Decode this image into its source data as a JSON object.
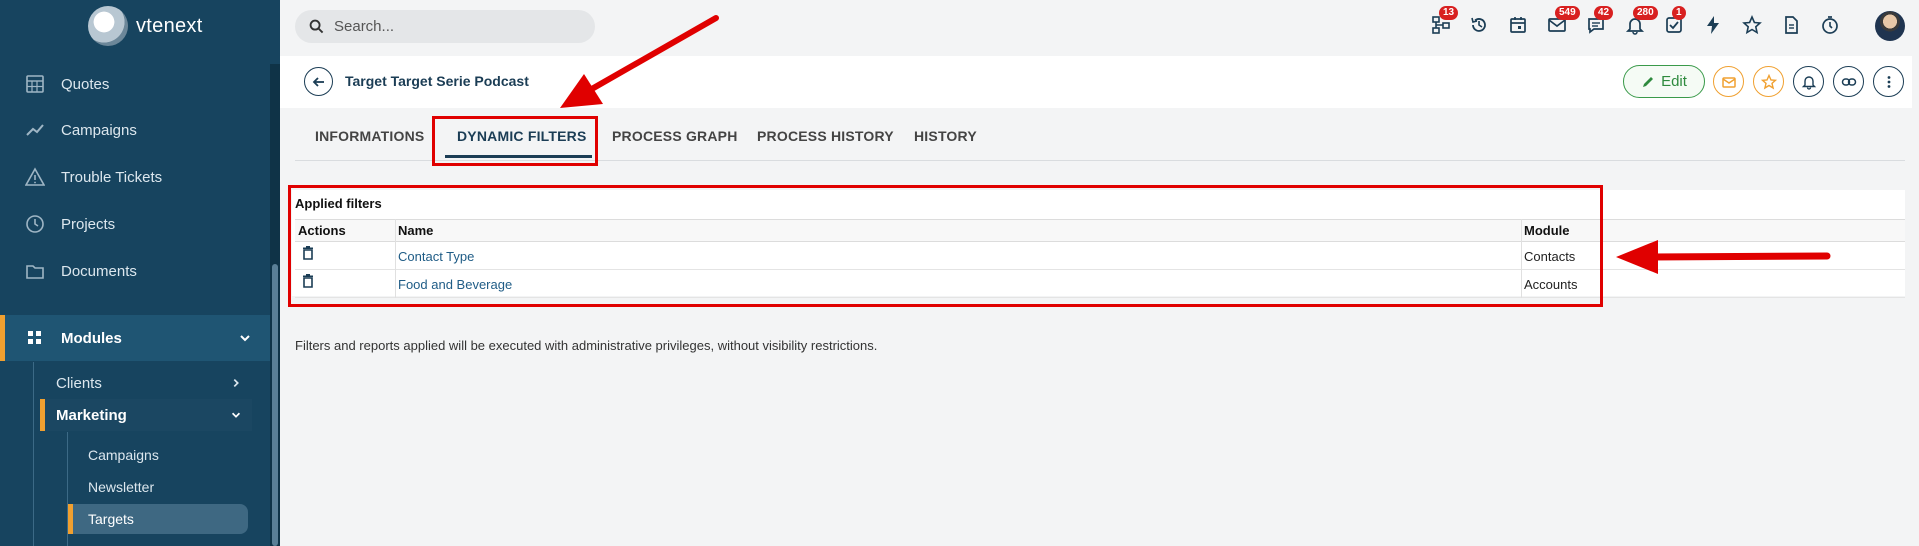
{
  "brand": {
    "name": "vtenext"
  },
  "sidebar": {
    "items": [
      {
        "label": "Quotes",
        "icon": "calculator-icon"
      },
      {
        "label": "Campaigns",
        "icon": "trend-icon"
      },
      {
        "label": "Trouble Tickets",
        "icon": "warning-icon"
      },
      {
        "label": "Projects",
        "icon": "clock-icon"
      },
      {
        "label": "Documents",
        "icon": "folder-icon"
      }
    ],
    "modules_label": "Modules",
    "sub_items": [
      {
        "label": "Clients"
      },
      {
        "label": "Marketing"
      }
    ],
    "marketing_items": [
      {
        "label": "Campaigns"
      },
      {
        "label": "Newsletter"
      },
      {
        "label": "Targets"
      }
    ]
  },
  "search": {
    "placeholder": "Search..."
  },
  "toolbar": {
    "badges": [
      "13",
      "549",
      "42",
      "280",
      "1"
    ]
  },
  "header": {
    "title": "Target Target Serie Podcast",
    "edit_label": "Edit"
  },
  "tabs": [
    "INFORMATIONS",
    "DYNAMIC FILTERS",
    "PROCESS GRAPH",
    "PROCESS HISTORY",
    "HISTORY"
  ],
  "filters": {
    "title": "Applied filters",
    "columns": [
      "Actions",
      "Name",
      "Module"
    ],
    "rows": [
      {
        "name": "Contact Type",
        "module": "Contacts"
      },
      {
        "name": "Food and Beverage",
        "module": "Accounts"
      }
    ],
    "note": "Filters and reports applied will be executed with administrative privileges, without visibility restrictions."
  },
  "colors": {
    "sidebar": "#17445f",
    "accent": "#f0a030",
    "annotation": "#e00000",
    "link": "#1f5c86"
  }
}
